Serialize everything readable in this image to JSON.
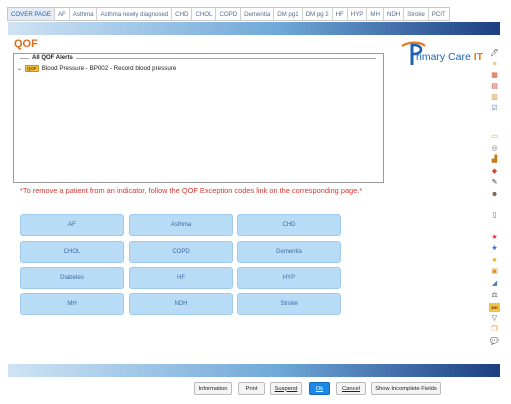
{
  "tabs": [
    {
      "label": "COVER PAGE",
      "active": true
    },
    {
      "label": "AF",
      "active": false
    },
    {
      "label": "Asthma",
      "active": false
    },
    {
      "label": "Asthma newly diagnosed",
      "active": false
    },
    {
      "label": "CHD",
      "active": false
    },
    {
      "label": "CHOL",
      "active": false
    },
    {
      "label": "COPD",
      "active": false
    },
    {
      "label": "Dementia",
      "active": false
    },
    {
      "label": "DM pg1",
      "active": false
    },
    {
      "label": "DM pg 2",
      "active": false
    },
    {
      "label": "HF",
      "active": false
    },
    {
      "label": "HYP",
      "active": false
    },
    {
      "label": "MH",
      "active": false
    },
    {
      "label": "NDH",
      "active": false
    },
    {
      "label": "Stroke",
      "active": false
    },
    {
      "label": "PCIT",
      "active": false
    }
  ],
  "page": {
    "title": "QOF"
  },
  "logo": {
    "text_main": "rimary Care ",
    "text_it": "IT"
  },
  "alerts": {
    "legend": "All QOF Alerts",
    "items": [
      {
        "expander": "⌄",
        "tag": "QOF",
        "text": "Blood Pressure - BP002 - Record blood pressure"
      }
    ]
  },
  "note": "*To remove a patient from an indicator, follow the QOF Exception codes link on the corresponding page.*",
  "indicators": [
    {
      "label": "AF"
    },
    {
      "label": "Asthma"
    },
    {
      "label": "CHD"
    },
    {
      "label": "CHOL"
    },
    {
      "label": "COPD"
    },
    {
      "label": "Dementia"
    },
    {
      "label": "Diabetes"
    },
    {
      "label": "HF"
    },
    {
      "label": "HYP"
    },
    {
      "label": "MH"
    },
    {
      "label": "NDH"
    },
    {
      "label": "Stroke"
    }
  ],
  "right_toolbar": [
    {
      "icon": "clipboard-pen-icon",
      "glyph": "🖊"
    },
    {
      "icon": "stack-icon",
      "glyph": "≡"
    },
    {
      "icon": "calendar-icon",
      "glyph": "▦"
    },
    {
      "icon": "calendar-alt-icon",
      "glyph": "▤"
    },
    {
      "icon": "book-icon",
      "glyph": "▥"
    },
    {
      "icon": "document-check-icon",
      "glyph": "☑"
    },
    {
      "icon": "label-icon",
      "glyph": "▭"
    },
    {
      "icon": "binoculars-icon",
      "glyph": "◎"
    },
    {
      "icon": "bar-chart-icon",
      "glyph": "▟"
    },
    {
      "icon": "pill-icon",
      "glyph": "◆"
    },
    {
      "icon": "pen-icon",
      "glyph": "✎"
    },
    {
      "icon": "person-icon",
      "glyph": "☻"
    },
    {
      "icon": "door-icon",
      "glyph": "▯"
    },
    {
      "icon": "star-red-icon",
      "glyph": "★"
    },
    {
      "icon": "star-blue-icon",
      "glyph": "★"
    },
    {
      "icon": "star-gold-icon",
      "glyph": "★"
    },
    {
      "icon": "note-icon",
      "glyph": "▣"
    },
    {
      "icon": "chart-line-icon",
      "glyph": "◢"
    },
    {
      "icon": "scales-icon",
      "glyph": "⚖"
    },
    {
      "icon": "mh-badge-icon",
      "glyph": "MH"
    },
    {
      "icon": "flask-icon",
      "glyph": "▽"
    },
    {
      "icon": "copy-icon",
      "glyph": "❐"
    },
    {
      "icon": "chat-icon",
      "glyph": "💬"
    }
  ],
  "buttons": {
    "information": "Information",
    "print": "Print",
    "suspend": "Suspend",
    "ok": "Ok",
    "cancel": "Cancel",
    "show_incomplete": "Show Incomplete Fields"
  },
  "colors": {
    "accent_title": "#e06a1a",
    "note_red": "#d8362e",
    "indicator_fill": "#b9dcf6",
    "ok_blue": "#1e88e5",
    "bar_dark": "#1c3f82"
  }
}
